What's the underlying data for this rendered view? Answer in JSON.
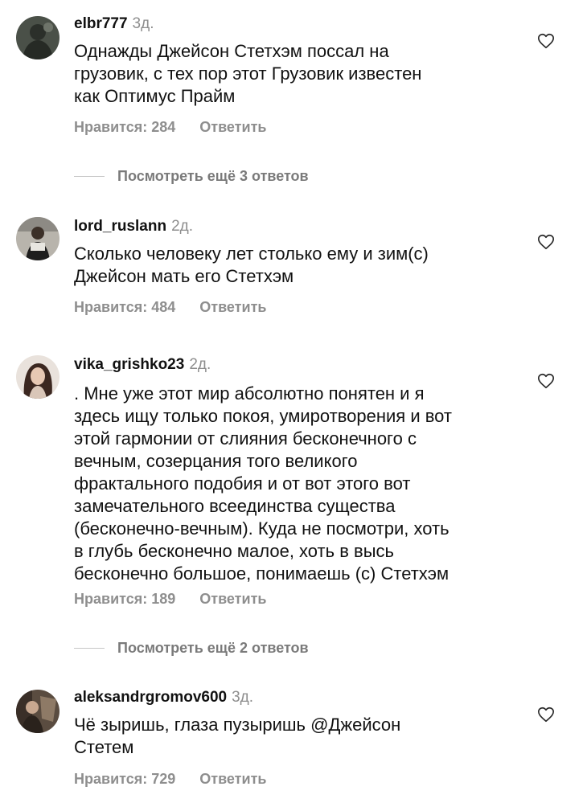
{
  "comments": [
    {
      "username": "elbr777",
      "time": "3д.",
      "text": "Однажды Джейсон Стетхэм поссал на\nгрузовик, с тех пор этот Грузовик известен\nкак Оптимус Прайм",
      "likes": "Нравится: 284",
      "reply": "Ответить"
    },
    {
      "username": "lord_ruslann",
      "time": "2д.",
      "text": "Сколько человеку лет столько ему и зим(с)\nДжейсон мать его Стетхэм",
      "likes": "Нравится: 484",
      "reply": "Ответить"
    },
    {
      "username": "vika_grishko23",
      "time": "2д.",
      "text": ". Мне уже этот мир абсолютно понятен и я\nздесь ищу только покоя, умиротворения и вот\nэтой гармонии от слияния бесконечного с\nвечным, созерцания того великого\nфрактального подобия и от вот этого вот\nзамечательного всеединства существа\n(бесконечно-вечным). Куда не посмотри, хоть\nв глубь бесконечно малое, хоть в высь\nбесконечно большое, понимаешь (с) Стетхэм",
      "likes": "Нравится: 189",
      "reply": "Ответить"
    },
    {
      "username": "aleksandrgromov600",
      "time": "3д.",
      "text": "Чё зыришь, глаза пузыришь @Джейсон\nСтетем",
      "likes": "Нравится: 729",
      "reply": "Ответить"
    }
  ],
  "view_more": [
    "Посмотреть ещё 3 ответов",
    "Посмотреть ещё 2 ответов"
  ],
  "icons": {
    "like": "heart-outline-icon"
  },
  "colors": {
    "text": "#111111",
    "secondary": "#8e8e8e",
    "divider": "#c7c7c7",
    "background": "#ffffff"
  }
}
